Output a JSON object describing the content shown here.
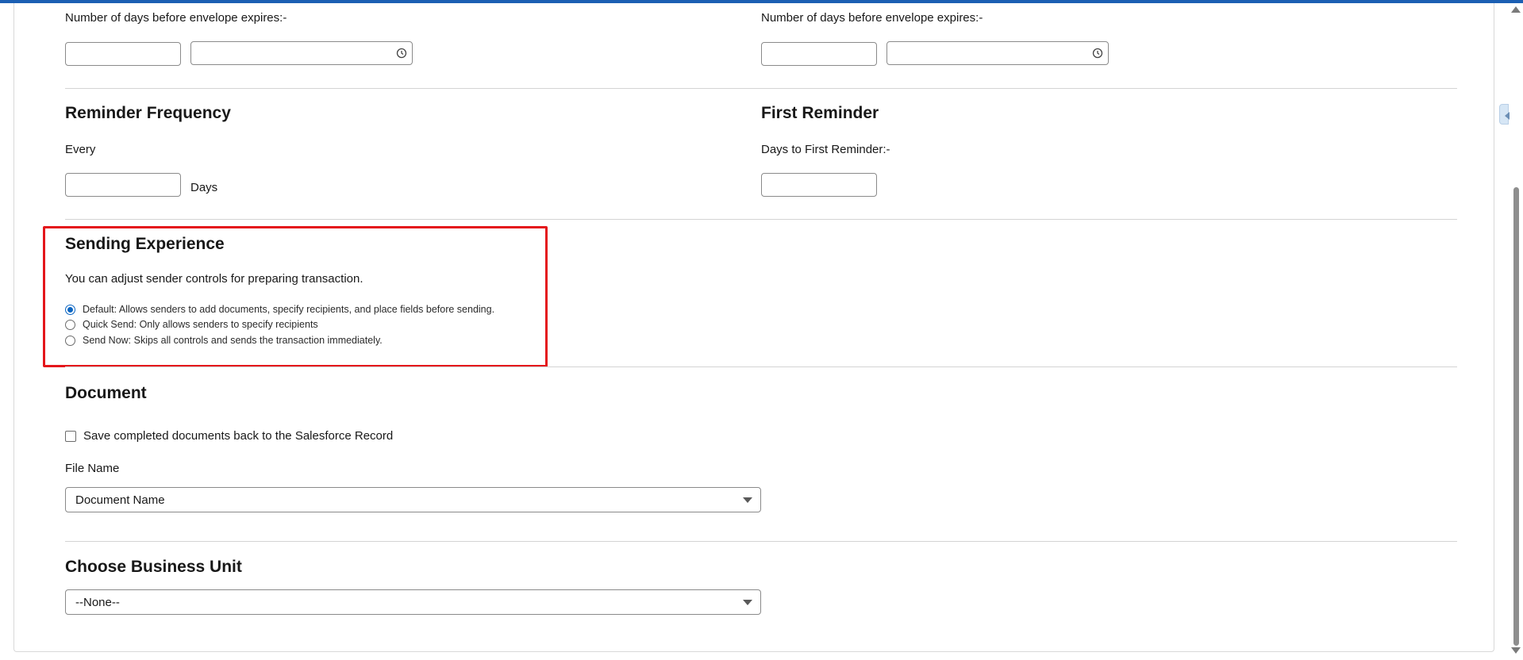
{
  "expiration": {
    "left_label": "Number of days before envelope expires:-",
    "right_label": "Number of days before envelope expires:-",
    "left_days_value": "",
    "left_time_value": "",
    "right_days_value": "",
    "right_time_value": ""
  },
  "reminder_frequency": {
    "title": "Reminder Frequency",
    "every_label": "Every",
    "days_value": "",
    "days_suffix": "Days"
  },
  "first_reminder": {
    "title": "First Reminder",
    "days_label": "Days to First Reminder:-",
    "days_value": ""
  },
  "sending_experience": {
    "title": "Sending Experience",
    "description": "You can adjust sender controls for preparing transaction.",
    "options": [
      {
        "label": "Default: Allows senders to add documents, specify recipients, and place fields before sending.",
        "selected": true
      },
      {
        "label": "Quick Send: Only allows senders to specify recipients",
        "selected": false
      },
      {
        "label": "Send Now: Skips all controls and sends the transaction immediately.",
        "selected": false
      }
    ],
    "highlight_color": "#e4161b"
  },
  "document": {
    "title": "Document",
    "save_checkbox_label": "Save completed documents back to the Salesforce Record",
    "save_checked": false,
    "file_name_label": "File Name",
    "file_name_selected": "Document Name"
  },
  "business_unit": {
    "title": "Choose Business Unit",
    "selected": "--None--"
  },
  "colors": {
    "accent": "#1b5fb3",
    "radio_selected": "#0b65c2"
  },
  "icons": {
    "time_picker": "clock-icon",
    "dropdown": "chevron-down-icon"
  }
}
